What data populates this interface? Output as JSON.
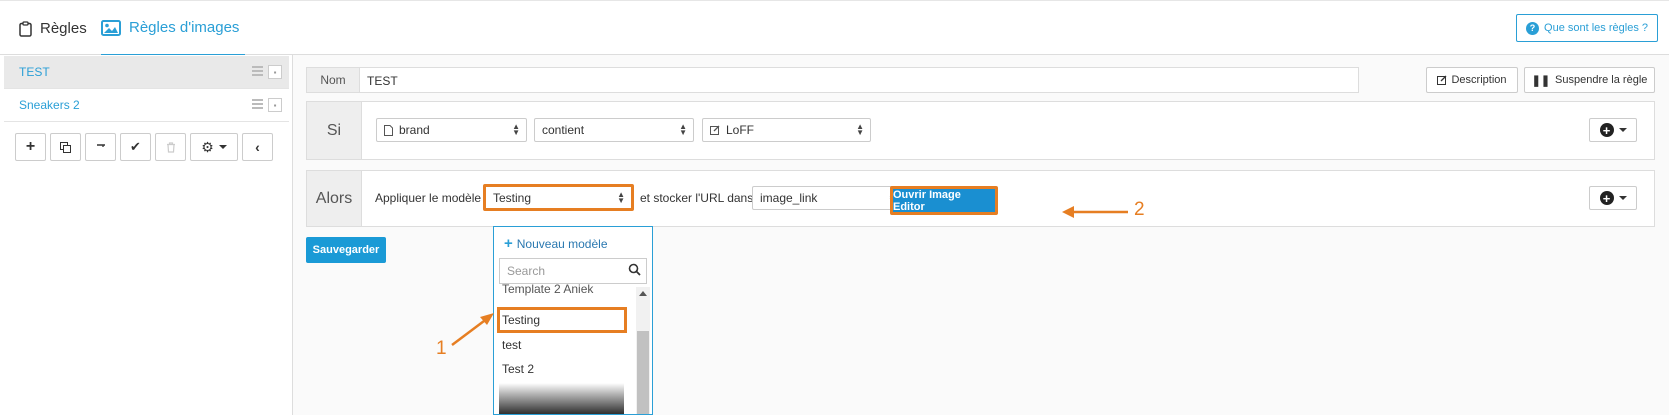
{
  "tabs": [
    {
      "label": "Règles",
      "icon": "clipboard-icon"
    },
    {
      "label": "Règles d'images",
      "icon": "image-icon",
      "active": true
    }
  ],
  "help": {
    "label": "Que sont les règles ?"
  },
  "sidebar": {
    "rules": [
      {
        "name": "TEST",
        "active": true
      },
      {
        "name": "Sneakers 2",
        "active": false
      }
    ]
  },
  "rule": {
    "nom_label": "Nom",
    "nom_value": "TEST",
    "description_label": "Description",
    "suspend_label": "Suspendre la règle"
  },
  "condition": {
    "label": "Si",
    "field": "brand",
    "operator": "contient",
    "value": "LoFF"
  },
  "action": {
    "label": "Alors",
    "apply_text": "Appliquer le modèle",
    "template_value": "Testing",
    "store_text": "et stocker l'URL dans",
    "store_field": "image_link",
    "editor_button": "Ouvrir Image Editor"
  },
  "save_label": "Sauvegarder",
  "dropdown": {
    "new_label": "Nouveau modèle",
    "search_placeholder": "Search",
    "items": [
      "Template 2 Aniek",
      "Testing",
      "test",
      "Test 2"
    ],
    "selected": "Testing"
  },
  "annotations": [
    "1",
    "2"
  ],
  "colors": {
    "accent": "#2a9fd6",
    "highlight": "#e67e22",
    "primary_button": "#1a8fd1"
  }
}
